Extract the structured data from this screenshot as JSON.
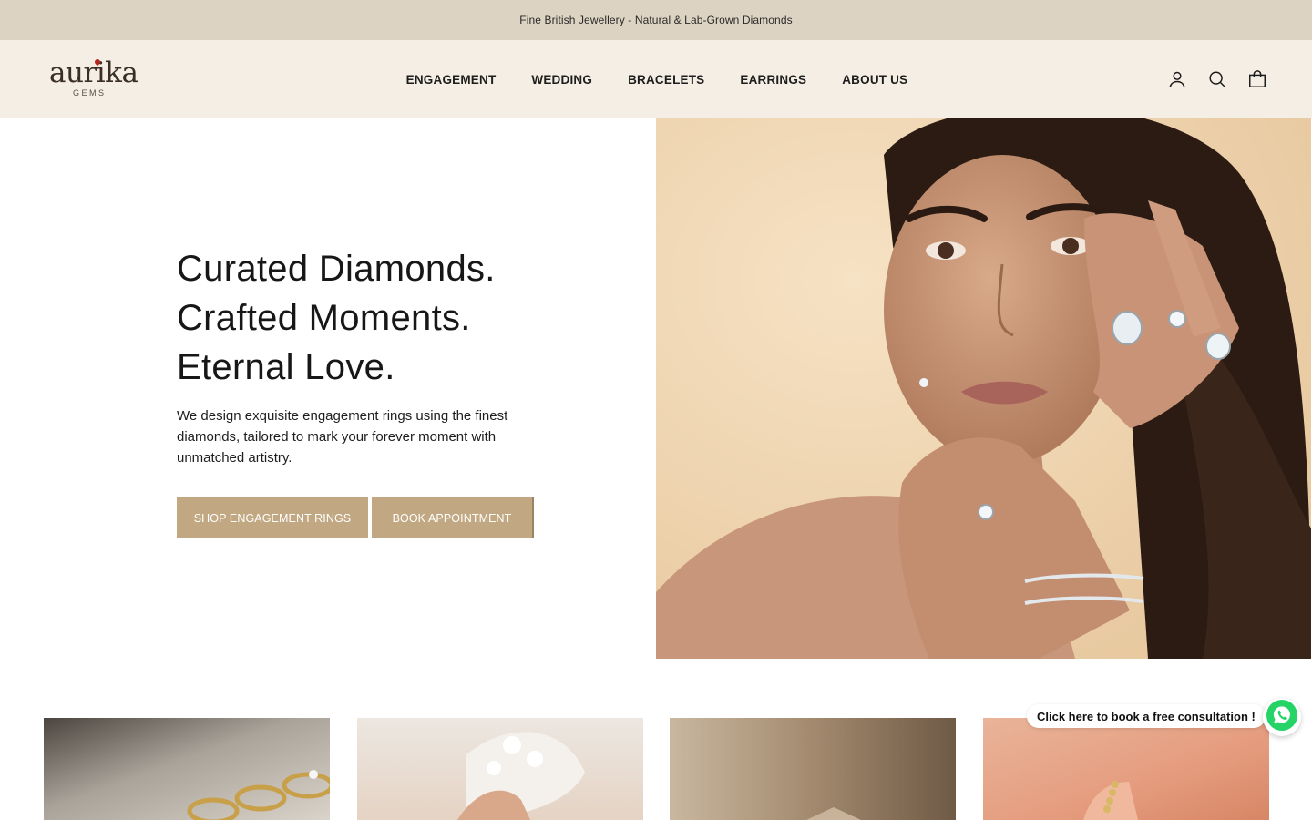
{
  "announcement": {
    "text": "Fine British Jewellery - Natural & Lab-Grown Diamonds"
  },
  "header": {
    "logo": {
      "word": "aurika",
      "sub": "GEMS"
    },
    "nav": [
      "ENGAGEMENT",
      "WEDDING",
      "BRACELETS",
      "EARRINGS",
      "ABOUT US"
    ],
    "icons": [
      "account-icon",
      "search-icon",
      "cart-icon"
    ]
  },
  "hero": {
    "title_lines": [
      "Curated Diamonds.",
      "Crafted Moments.",
      "Eternal Love."
    ],
    "description": "We design exquisite engagement rings using the finest diamonds, tailored to mark your forever moment with unmatched artistry.",
    "buttons": {
      "shop": "SHOP ENGAGEMENT RINGS",
      "book": "BOOK APPOINTMENT"
    }
  },
  "whatsapp": {
    "bubble": "Click here to book a free consultation !",
    "icon": "whatsapp-icon"
  },
  "colors": {
    "announce_bg": "#ddd3c2",
    "header_bg": "#f5eee4",
    "button_bg": "#c1a882",
    "whatsapp": "#25d366"
  }
}
